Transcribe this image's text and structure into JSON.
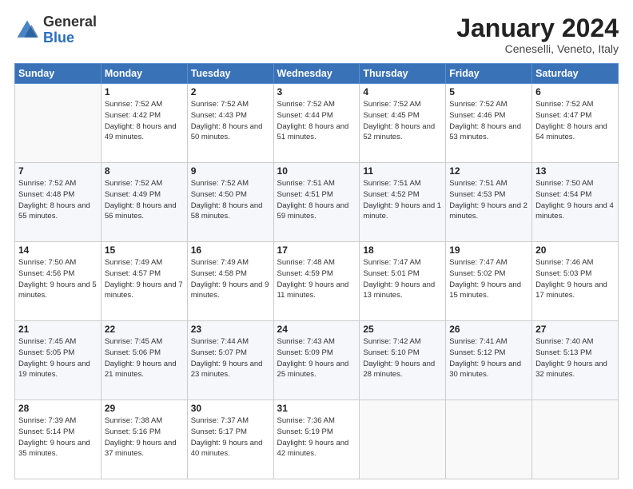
{
  "header": {
    "logo_general": "General",
    "logo_blue": "Blue",
    "month_title": "January 2024",
    "location": "Ceneselli, Veneto, Italy"
  },
  "weekdays": [
    "Sunday",
    "Monday",
    "Tuesday",
    "Wednesday",
    "Thursday",
    "Friday",
    "Saturday"
  ],
  "weeks": [
    [
      null,
      {
        "day": 1,
        "sunrise": "7:52 AM",
        "sunset": "4:42 PM",
        "daylight": "8 hours and 49 minutes."
      },
      {
        "day": 2,
        "sunrise": "7:52 AM",
        "sunset": "4:43 PM",
        "daylight": "8 hours and 50 minutes."
      },
      {
        "day": 3,
        "sunrise": "7:52 AM",
        "sunset": "4:44 PM",
        "daylight": "8 hours and 51 minutes."
      },
      {
        "day": 4,
        "sunrise": "7:52 AM",
        "sunset": "4:45 PM",
        "daylight": "8 hours and 52 minutes."
      },
      {
        "day": 5,
        "sunrise": "7:52 AM",
        "sunset": "4:46 PM",
        "daylight": "8 hours and 53 minutes."
      },
      {
        "day": 6,
        "sunrise": "7:52 AM",
        "sunset": "4:47 PM",
        "daylight": "8 hours and 54 minutes."
      }
    ],
    [
      {
        "day": 7,
        "sunrise": "7:52 AM",
        "sunset": "4:48 PM",
        "daylight": "8 hours and 55 minutes."
      },
      {
        "day": 8,
        "sunrise": "7:52 AM",
        "sunset": "4:49 PM",
        "daylight": "8 hours and 56 minutes."
      },
      {
        "day": 9,
        "sunrise": "7:52 AM",
        "sunset": "4:50 PM",
        "daylight": "8 hours and 58 minutes."
      },
      {
        "day": 10,
        "sunrise": "7:51 AM",
        "sunset": "4:51 PM",
        "daylight": "8 hours and 59 minutes."
      },
      {
        "day": 11,
        "sunrise": "7:51 AM",
        "sunset": "4:52 PM",
        "daylight": "9 hours and 1 minute."
      },
      {
        "day": 12,
        "sunrise": "7:51 AM",
        "sunset": "4:53 PM",
        "daylight": "9 hours and 2 minutes."
      },
      {
        "day": 13,
        "sunrise": "7:50 AM",
        "sunset": "4:54 PM",
        "daylight": "9 hours and 4 minutes."
      }
    ],
    [
      {
        "day": 14,
        "sunrise": "7:50 AM",
        "sunset": "4:56 PM",
        "daylight": "9 hours and 5 minutes."
      },
      {
        "day": 15,
        "sunrise": "7:49 AM",
        "sunset": "4:57 PM",
        "daylight": "9 hours and 7 minutes."
      },
      {
        "day": 16,
        "sunrise": "7:49 AM",
        "sunset": "4:58 PM",
        "daylight": "9 hours and 9 minutes."
      },
      {
        "day": 17,
        "sunrise": "7:48 AM",
        "sunset": "4:59 PM",
        "daylight": "9 hours and 11 minutes."
      },
      {
        "day": 18,
        "sunrise": "7:47 AM",
        "sunset": "5:01 PM",
        "daylight": "9 hours and 13 minutes."
      },
      {
        "day": 19,
        "sunrise": "7:47 AM",
        "sunset": "5:02 PM",
        "daylight": "9 hours and 15 minutes."
      },
      {
        "day": 20,
        "sunrise": "7:46 AM",
        "sunset": "5:03 PM",
        "daylight": "9 hours and 17 minutes."
      }
    ],
    [
      {
        "day": 21,
        "sunrise": "7:45 AM",
        "sunset": "5:05 PM",
        "daylight": "9 hours and 19 minutes."
      },
      {
        "day": 22,
        "sunrise": "7:45 AM",
        "sunset": "5:06 PM",
        "daylight": "9 hours and 21 minutes."
      },
      {
        "day": 23,
        "sunrise": "7:44 AM",
        "sunset": "5:07 PM",
        "daylight": "9 hours and 23 minutes."
      },
      {
        "day": 24,
        "sunrise": "7:43 AM",
        "sunset": "5:09 PM",
        "daylight": "9 hours and 25 minutes."
      },
      {
        "day": 25,
        "sunrise": "7:42 AM",
        "sunset": "5:10 PM",
        "daylight": "9 hours and 28 minutes."
      },
      {
        "day": 26,
        "sunrise": "7:41 AM",
        "sunset": "5:12 PM",
        "daylight": "9 hours and 30 minutes."
      },
      {
        "day": 27,
        "sunrise": "7:40 AM",
        "sunset": "5:13 PM",
        "daylight": "9 hours and 32 minutes."
      }
    ],
    [
      {
        "day": 28,
        "sunrise": "7:39 AM",
        "sunset": "5:14 PM",
        "daylight": "9 hours and 35 minutes."
      },
      {
        "day": 29,
        "sunrise": "7:38 AM",
        "sunset": "5:16 PM",
        "daylight": "9 hours and 37 minutes."
      },
      {
        "day": 30,
        "sunrise": "7:37 AM",
        "sunset": "5:17 PM",
        "daylight": "9 hours and 40 minutes."
      },
      {
        "day": 31,
        "sunrise": "7:36 AM",
        "sunset": "5:19 PM",
        "daylight": "9 hours and 42 minutes."
      },
      null,
      null,
      null
    ]
  ]
}
